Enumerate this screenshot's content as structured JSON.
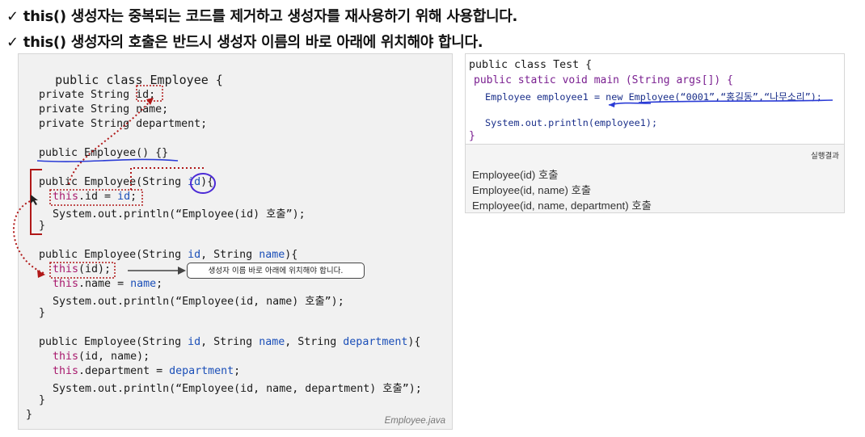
{
  "bullets": {
    "check": "✓",
    "line1": "this() 생성자는 중복되는 코드를 제거하고 생성자를 재사용하기 위해 사용합니다.",
    "line2": "this() 생성자의 호출은 반드시 생성자 이름의 바로 아래에 위치해야 합니다."
  },
  "employee_code": {
    "l1": "public class Employee {",
    "l2a": "private String ",
    "l2b": "id",
    "l2c": ";",
    "l3": "private String name;",
    "l4": "private String department;",
    "l5": "public Employee() {}",
    "l6a": "public Employee(String ",
    "l6b": "id",
    "l6c": "){",
    "l7a": "this",
    "l7b": ".id = ",
    "l7c": "id",
    "l7d": ";",
    "l8": "System.out.println(“Employee(id) 호출”);",
    "l9": "}",
    "l10a": "public Employee(String ",
    "l10b": "id",
    "l10c": ", String ",
    "l10d": "name",
    "l10e": "){",
    "l11a": "this",
    "l11b": "(id);",
    "l12a": "this",
    "l12b": ".name = ",
    "l12c": "name",
    "l12d": ";",
    "l13": "System.out.println(“Employee(id, name) 호출”);",
    "l14": "}",
    "l15a": "public Employee(String ",
    "l15b": "id",
    "l15c": ", String ",
    "l15d": "name",
    "l15e": ", String ",
    "l15f": "department",
    "l15g": "){",
    "l16a": "this",
    "l16b": "(id, name);",
    "l17a": "this",
    "l17b": ".department = ",
    "l17c": "department",
    "l17d": ";",
    "l18": "System.out.println(“Employee(id, name, department) 호출”);",
    "l19": "}",
    "l20": "}",
    "file": "Employee.java"
  },
  "callout": "생성자 이름 바로 아래에 위치해야 합니다.",
  "test_code": {
    "l1": "public class Test {",
    "l2": "public static void main (String args[]) {",
    "l3a": "Employee employee1 = ",
    "l3b": "new",
    "l3c": " Employee(“0001”,“홍길동”,“나무소리”);",
    "l4": "System.out.println(employee1);",
    "l5": "}"
  },
  "output": {
    "label": "실행결과",
    "lines": [
      "Employee(id) 호출",
      "Employee(id, name) 호출",
      "Employee(id, name, department) 호출"
    ]
  },
  "colors": {
    "keyword": "#7a1f90",
    "this": "#a8196d",
    "param": "#1b4fb8",
    "annotation_red": "#b01818",
    "annotation_blue": "#2a3bd6"
  }
}
